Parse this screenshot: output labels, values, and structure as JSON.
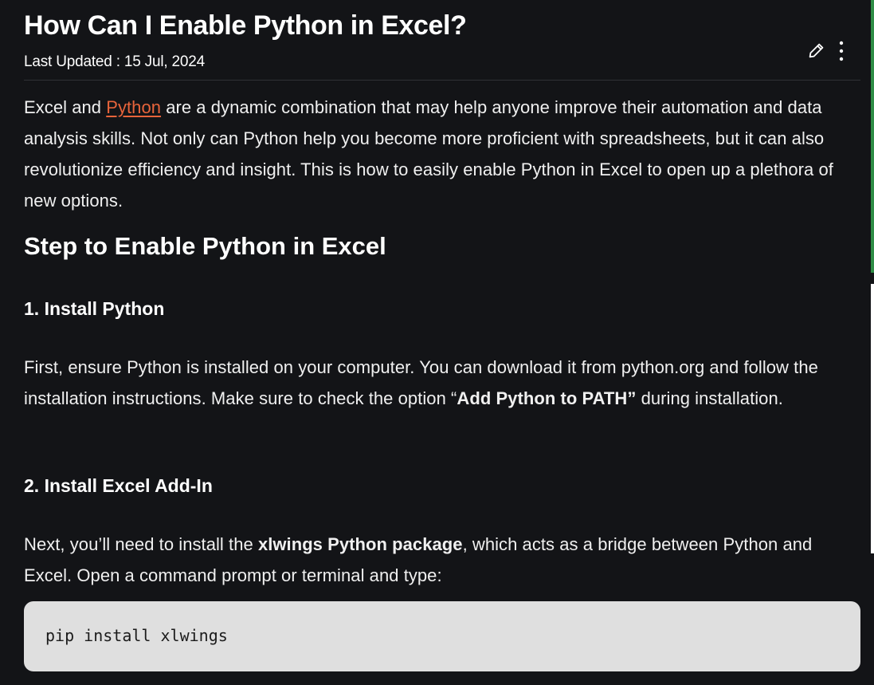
{
  "article": {
    "title": "How Can I Enable Python in Excel?",
    "updated": "Last Updated : 15 Jul, 2024",
    "intro": {
      "before": "Excel and ",
      "link": "Python",
      "after": " are a dynamic combination that may help anyone improve their automation and data analysis skills. Not only can Python help you become more proficient with spreadsheets, but it can also revolutionize efficiency and insight. This is how to easily enable Python in Excel to open up a plethora of new options."
    },
    "section_heading": "Step to Enable Python in Excel",
    "step1": {
      "heading": "1. Install Python",
      "text_before": "First, ensure Python is installed on your computer. You can download it from python.org and follow the installation instructions. Make sure to check the option “",
      "text_bold": "Add Python to PATH”",
      "text_after": " during installation."
    },
    "step2": {
      "heading": "2. Install Excel Add-In",
      "text_before": "Next, you’ll need to install the ",
      "text_bold": "xlwings Python package",
      "text_after": ", which acts as a bridge between Python and Excel. Open a command prompt or terminal and type:"
    },
    "code": "pip install xlwings"
  },
  "icons": {
    "edit": "pencil-icon",
    "more": "more-vertical-icon"
  },
  "colors": {
    "background": "#131417",
    "link": "#e8643b",
    "code_background": "#dfdfdf",
    "accent": "#2f8d46"
  }
}
